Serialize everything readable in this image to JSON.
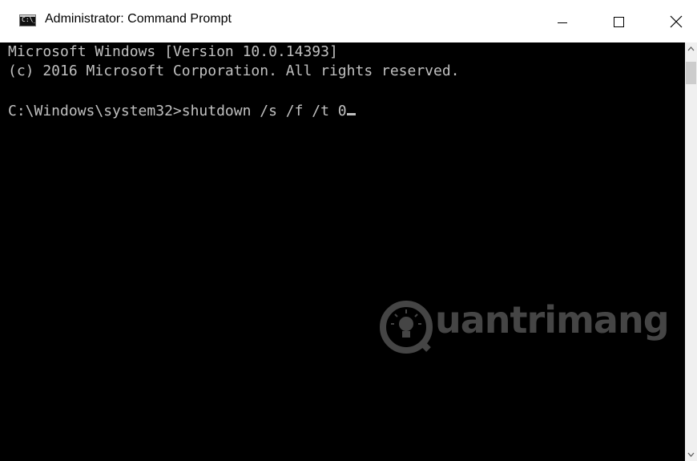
{
  "window": {
    "title": "Administrator: Command Prompt",
    "icon": "cmd-icon",
    "icon_text": "C:\\_",
    "controls": {
      "minimize_icon": "minimize-icon",
      "maximize_icon": "maximize-icon",
      "close_icon": "close-icon"
    }
  },
  "console": {
    "lines": [
      "Microsoft Windows [Version 10.0.14393]",
      "(c) 2016 Microsoft Corporation. All rights reserved.",
      "",
      "C:\\Windows\\system32>shutdown /s /f /t 0"
    ],
    "text_color": "#c0c0c0",
    "background": "#000000"
  },
  "watermark": {
    "text": "uantrimang"
  }
}
